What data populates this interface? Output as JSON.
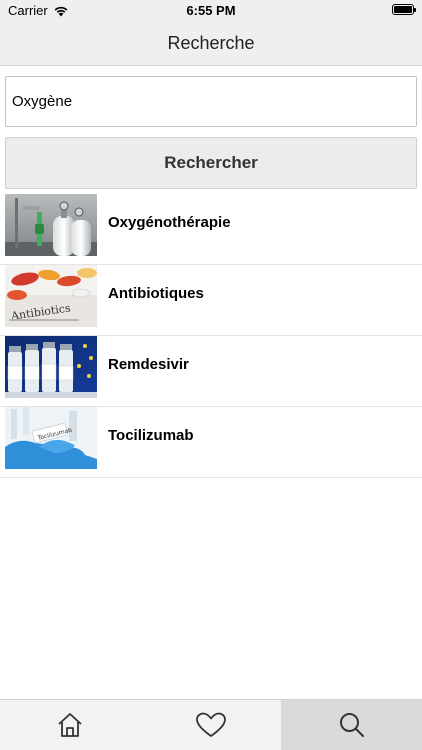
{
  "status_bar": {
    "carrier": "Carrier",
    "time": "6:55 PM",
    "icons": [
      "wifi-icon",
      "battery-icon"
    ]
  },
  "nav": {
    "title": "Recherche"
  },
  "search": {
    "value": "Oxygène",
    "placeholder": "",
    "button_label": "Rechercher"
  },
  "results": [
    {
      "label": "Oxygénothérapie",
      "thumbnail": "oxygen-cylinders-photo"
    },
    {
      "label": "Antibiotiques",
      "thumbnail": "antibiotic-pills-photo"
    },
    {
      "label": "Remdesivir",
      "thumbnail": "remdesivir-vials-photo"
    },
    {
      "label": "Tocilizumab",
      "thumbnail": "tocilizumab-gloved-hand-photo"
    }
  ],
  "tab_bar": {
    "tabs": [
      {
        "name": "home",
        "icon": "home-icon",
        "active": false
      },
      {
        "name": "favorites",
        "icon": "heart-icon",
        "active": false
      },
      {
        "name": "search",
        "icon": "search-icon",
        "active": true
      }
    ]
  },
  "colors": {
    "bar_background": "#efefef",
    "active_tab": "#dadada",
    "button_background": "#ececec"
  }
}
